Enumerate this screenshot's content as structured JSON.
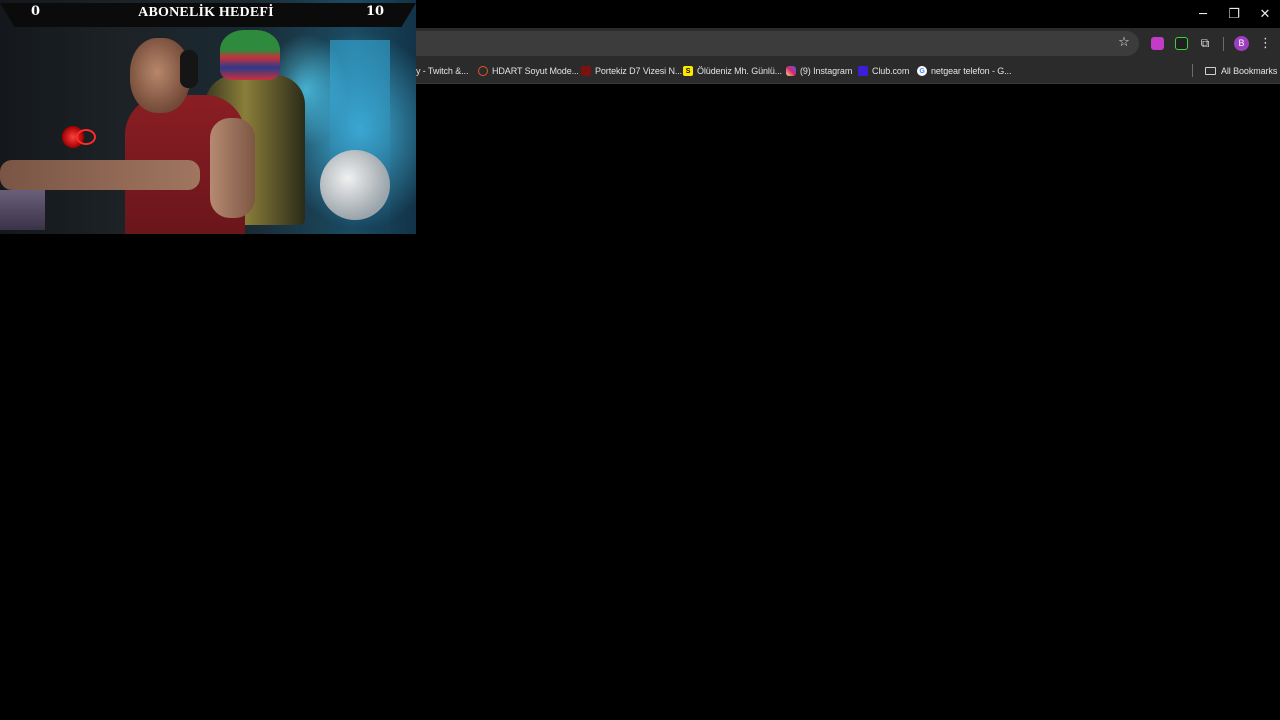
{
  "window_controls": {
    "minimize": "─",
    "restore": "❐",
    "close": "✕"
  },
  "bookmarks": [
    {
      "label": "y - Twitch &...",
      "icon": "twitch-icon",
      "color": "#9146ff"
    },
    {
      "label": "HDART Soyut Mode...",
      "icon": "hdart-icon",
      "color": "#e0542a"
    },
    {
      "label": "Portekiz D7 Vizesi N...",
      "icon": "portekiz-icon",
      "color": "#7a1212"
    },
    {
      "label": "Ölüdeniz Mh. Günlü...",
      "icon": "sahibinden-icon",
      "color": "#ffe800",
      "glyph": "S"
    },
    {
      "label": "(9) Instagram",
      "icon": "instagram-icon",
      "color": "#d62976"
    },
    {
      "label": "Club.com",
      "icon": "club-icon",
      "color": "#3b1fd6"
    },
    {
      "label": "netgear telefon - G...",
      "icon": "google-icon",
      "color": "#ffffff",
      "glyph": "G"
    }
  ],
  "all_bookmarks": "All Bookmarks",
  "profile_initial": "B",
  "overlay": {
    "title": "ABONELİK HEDEFİ",
    "start": "0",
    "goal": "10"
  },
  "colors": {
    "toolbar": "#2b2b2b",
    "omnibox": "#3c3c3c",
    "avatar": "#9b3fbf"
  }
}
